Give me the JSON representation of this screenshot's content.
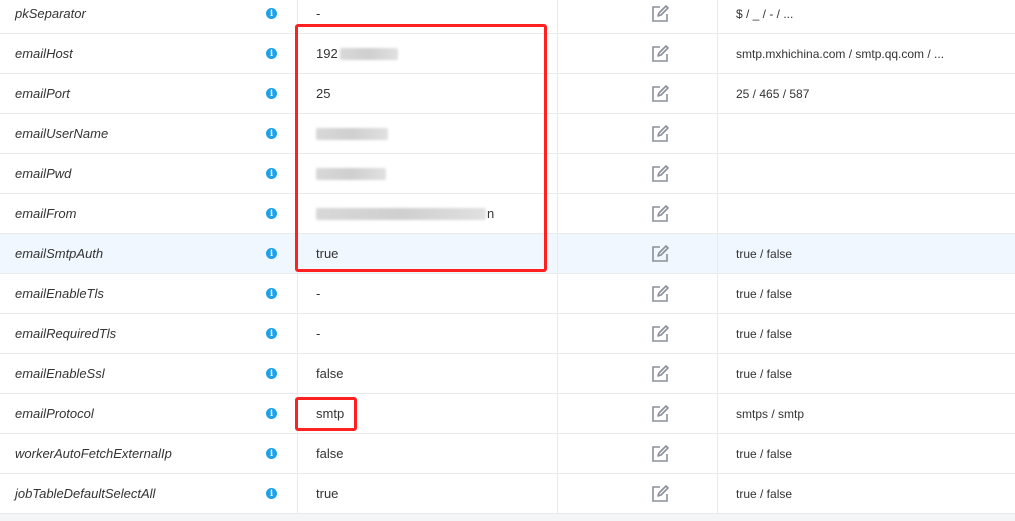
{
  "rows": [
    {
      "name": "pkSeparator",
      "value": "-",
      "options": "$ / _ / - / ..."
    },
    {
      "name": "emailHost",
      "value": "192",
      "options": "smtp.mxhichina.com / smtp.qq.com / ..."
    },
    {
      "name": "emailPort",
      "value": "25",
      "options": "25 / 465 / 587"
    },
    {
      "name": "emailUserName",
      "value": "",
      "options": ""
    },
    {
      "name": "emailPwd",
      "value": "",
      "options": ""
    },
    {
      "name": "emailFrom",
      "value": "n",
      "options": ""
    },
    {
      "name": "emailSmtpAuth",
      "value": "true",
      "options": "true / false"
    },
    {
      "name": "emailEnableTls",
      "value": "-",
      "options": "true / false"
    },
    {
      "name": "emailRequiredTls",
      "value": "-",
      "options": "true / false"
    },
    {
      "name": "emailEnableSsl",
      "value": "false",
      "options": "true / false"
    },
    {
      "name": "emailProtocol",
      "value": "smtp",
      "options": "smtps / smtp"
    },
    {
      "name": "workerAutoFetchExternalIp",
      "value": "false",
      "options": "true / false"
    },
    {
      "name": "jobTableDefaultSelectAll",
      "value": "true",
      "options": "true / false"
    }
  ],
  "info_icon_glyph": "i",
  "edit_icon": "edit-icon",
  "colors": {
    "highlight_row": "#f0f7ff",
    "info_icon": "#1ea1e8",
    "annotation_box": "#ff2020"
  }
}
